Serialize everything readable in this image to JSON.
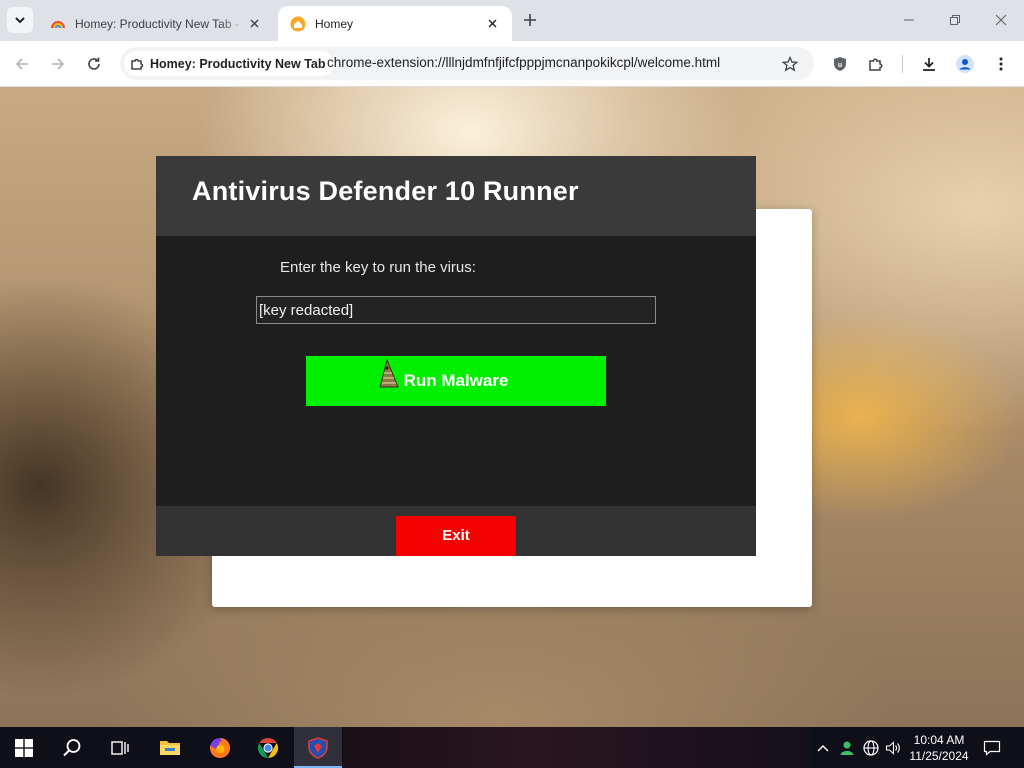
{
  "browser": {
    "tabs": [
      {
        "title": "Homey: Productivity New Tab - ",
        "active": false,
        "favicon": "rainbow-icon"
      },
      {
        "title": "Homey",
        "active": true,
        "favicon": "homey-house-icon"
      }
    ],
    "site_chip_label": "Homey: Productivity New Tab",
    "url": "chrome-extension://lllnjdmfnfjifcfpppjmcnanpokikcpl/welcome.html"
  },
  "app": {
    "title": "Antivirus Defender 10 Runner",
    "prompt": "Enter the key to run the virus:",
    "key_value": "[key redacted]",
    "run_button_label": "Run Malware",
    "exit_button_label": "Exit",
    "colors": {
      "header": "#3a3a3a",
      "body": "#1e1e1e",
      "run": "#00f000",
      "exit": "#f30000"
    }
  },
  "taskbar": {
    "apps": [
      "windows-start-icon",
      "search-icon",
      "task-view-icon",
      "file-explorer-icon",
      "firefox-icon",
      "chrome-icon",
      "shield-app-icon"
    ],
    "clock": {
      "time": "10:04 AM",
      "date": "11/25/2024"
    }
  }
}
